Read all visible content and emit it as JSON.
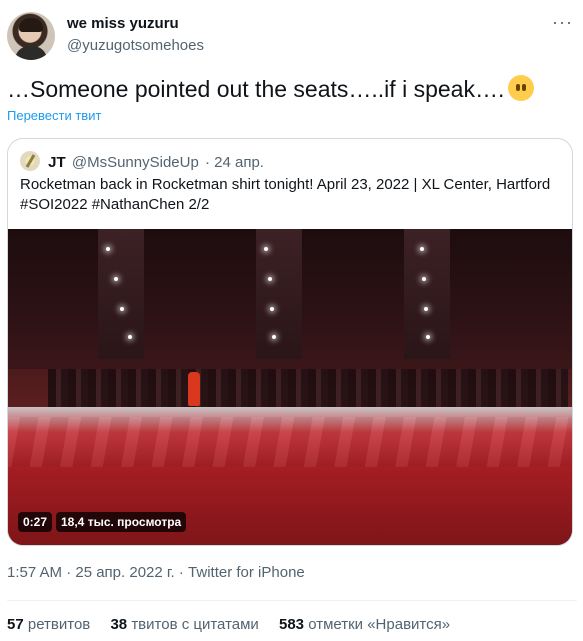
{
  "author": {
    "name": "we miss yuzuru",
    "handle": "@yuzugotsomehoes",
    "more": "···"
  },
  "tweet": {
    "text": "…Someone pointed out the seats…..if i speak….",
    "translate": "Перевести твит"
  },
  "quoted": {
    "name": "JT",
    "handle": "@MsSunnySideUp",
    "date": "· 24 апр.",
    "text": "Rocketman back in Rocketman shirt tonight! April 23, 2022 | XL Center, Hartford #SOI2022 #NathanChen 2/2",
    "video": {
      "duration": "0:27",
      "views": "18,4 тыс. просмотра"
    }
  },
  "timestamp": "1:57 AM · 25 апр. 2022 г. · Twitter for iPhone",
  "stats": {
    "retweets_count": "57",
    "retweets_label": "ретвитов",
    "quotes_count": "38",
    "quotes_label": "твитов с цитатами",
    "likes_count": "583",
    "likes_label": "отметки «Нравится»"
  },
  "colors": {
    "link": "#1d9bf0",
    "secondary": "#536471",
    "text": "#0f1419"
  },
  "icons": {
    "emoji": "face-without-mouth-emoji",
    "more": "more-icon"
  }
}
